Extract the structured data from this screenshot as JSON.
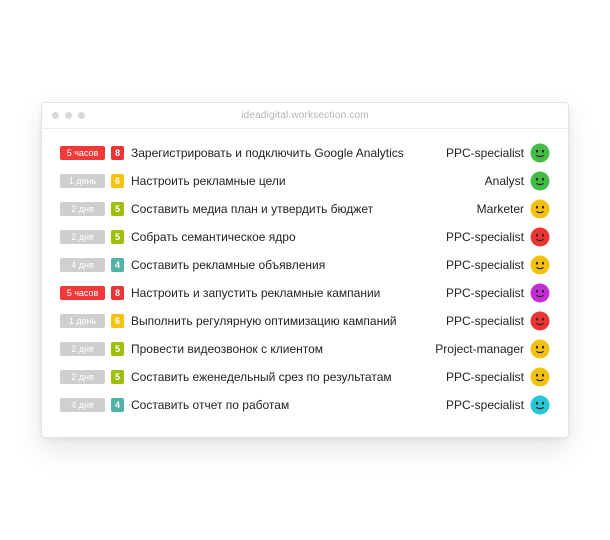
{
  "window": {
    "url": "ideadigital.worksection.com"
  },
  "colors": {
    "duration_hours": "#f03a3a",
    "duration_days": "#cfcfcf",
    "priority_8": "#ee3333",
    "priority_6": "#f7c20e",
    "priority_5": "#9dbf0c",
    "priority_4": "#4fb3a8",
    "avatar_green": "#44bb44",
    "avatar_yellow": "#f4c20e",
    "avatar_red": "#ee3333",
    "avatar_purple": "#c52ed6",
    "avatar_cyan": "#26c6d6"
  },
  "tasks": [
    {
      "duration": "5 часов",
      "duration_type": "hours",
      "priority": "8",
      "title": "Зарегистрировать и подключить Google Analytics",
      "assignee": "PPC-specialist",
      "avatar_color": "green"
    },
    {
      "duration": "1 день",
      "duration_type": "days",
      "priority": "6",
      "title": "Настроить рекламные цели",
      "assignee": "Analyst",
      "avatar_color": "green"
    },
    {
      "duration": "2 дня",
      "duration_type": "days",
      "priority": "5",
      "title": "Составить медиа план и утвердить бюджет",
      "assignee": "Marketer",
      "avatar_color": "yellow"
    },
    {
      "duration": "2 дня",
      "duration_type": "days",
      "priority": "5",
      "title": "Собрать семантическое ядро",
      "assignee": "PPC-specialist",
      "avatar_color": "red"
    },
    {
      "duration": "4 дня",
      "duration_type": "days",
      "priority": "4",
      "title": "Составить рекламные объявления",
      "assignee": "PPC-specialist",
      "avatar_color": "yellow"
    },
    {
      "duration": "5 часов",
      "duration_type": "hours",
      "priority": "8",
      "title": "Настроить и запустить рекламные кампании",
      "assignee": "PPC-specialist",
      "avatar_color": "purple"
    },
    {
      "duration": "1 день",
      "duration_type": "days",
      "priority": "6",
      "title": "Выполнить регулярную оптимизацию кампаний",
      "assignee": "PPC-specialist",
      "avatar_color": "red"
    },
    {
      "duration": "2 дня",
      "duration_type": "days",
      "priority": "5",
      "title": "Провести видеозвонок с клиентом",
      "assignee": "Project-manager",
      "avatar_color": "yellow"
    },
    {
      "duration": "2 дня",
      "duration_type": "days",
      "priority": "5",
      "title": "Составить еженедельный срез по результатам",
      "assignee": "PPC-specialist",
      "avatar_color": "yellow"
    },
    {
      "duration": "4 дня",
      "duration_type": "days",
      "priority": "4",
      "title": "Составить отчет по работам",
      "assignee": "PPC-specialist",
      "avatar_color": "cyan"
    }
  ]
}
